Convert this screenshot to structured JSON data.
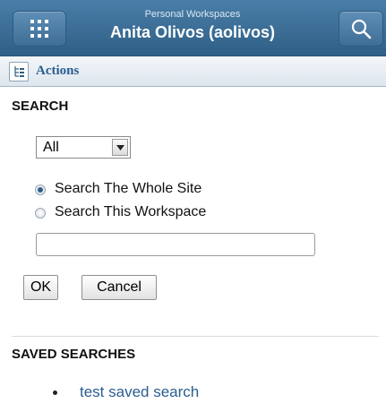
{
  "header": {
    "subtitle": "Personal Workspaces",
    "title": "Anita Olivos (aolivos)"
  },
  "actions_bar": {
    "label": "Actions"
  },
  "search": {
    "heading": "SEARCH",
    "scope_selected": "All",
    "radio_options": [
      {
        "label": "Search The Whole Site",
        "checked": true
      },
      {
        "label": "Search This Workspace",
        "checked": false
      }
    ],
    "query_value": "",
    "ok_label": "OK",
    "cancel_label": "Cancel"
  },
  "saved_searches": {
    "heading": "SAVED SEARCHES",
    "items": [
      "test saved search"
    ]
  },
  "colors": {
    "header_bg": "#3d6e96",
    "link": "#2a5d8f"
  },
  "icons": [
    "apps-grid-icon",
    "search-icon",
    "tree-icon",
    "dropdown-arrow-icon"
  ]
}
